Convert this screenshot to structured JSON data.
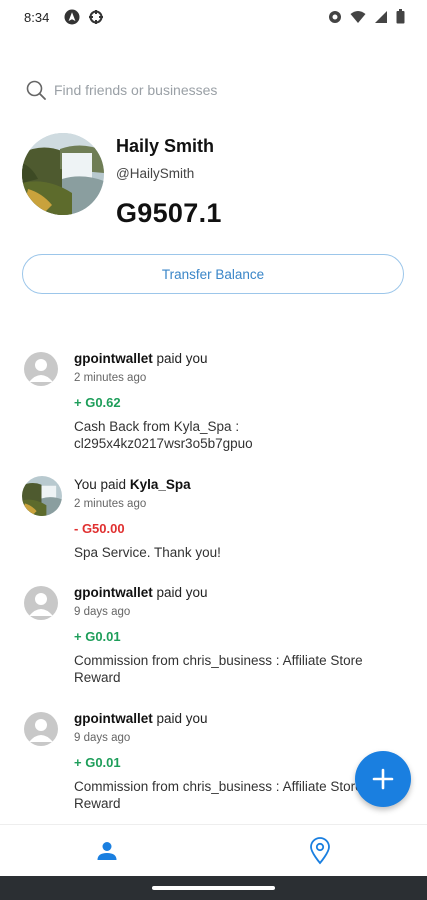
{
  "status_bar": {
    "time": "8:34",
    "left_icons": [
      "navigation-icon",
      "settings-wheel-icon"
    ],
    "right_icons": [
      "eye-icon",
      "wifi-icon",
      "signal-icon",
      "battery-icon"
    ]
  },
  "search": {
    "placeholder": "Find friends or businesses"
  },
  "profile": {
    "name": "Haily Smith",
    "handle": "@HailySmith",
    "balance": "G9507.1"
  },
  "actions": {
    "transfer_label": "Transfer Balance"
  },
  "feed": [
    {
      "actor": "gpointwallet",
      "action": "paid you",
      "time": "2 minutes ago",
      "amount": "+ G0.62",
      "amount_type": "positive",
      "note": "Cash Back from Kyla_Spa : cl295x4kz0217wsr3o5b7gpuo",
      "avatar": "default-avatar-icon"
    },
    {
      "prefix": "You paid",
      "actor": "Kyla_Spa",
      "time": "2 minutes ago",
      "amount": "- G50.00",
      "amount_type": "negative",
      "note": "Spa Service. Thank you!",
      "avatar": "waterfall-photo"
    },
    {
      "actor": "gpointwallet",
      "action": "paid you",
      "time": "9 days ago",
      "amount": "+ G0.01",
      "amount_type": "positive",
      "note": "Commission from chris_business : Affiliate Store Reward",
      "avatar": "default-avatar-icon"
    },
    {
      "actor": "gpointwallet",
      "action": "paid you",
      "time": "9 days ago",
      "amount": "+ G0.01",
      "amount_type": "positive",
      "note": "Commission from chris_business : Affiliate Store Reward",
      "avatar": "default-avatar-icon"
    }
  ],
  "colors": {
    "accent": "#1a7fe0",
    "positive": "#1e9e5a",
    "negative": "#e03030",
    "button_border": "#9cc6ea"
  },
  "fab": {
    "icon": "plus-icon"
  },
  "bottom_nav": [
    {
      "icon": "person-icon",
      "active": true
    },
    {
      "icon": "location-pin-icon",
      "active": false
    }
  ]
}
